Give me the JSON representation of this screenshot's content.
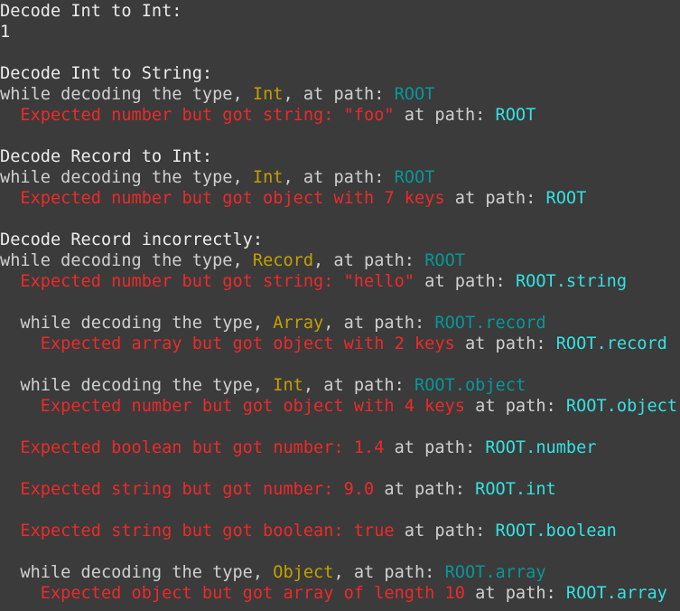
{
  "terminal": {
    "lines": [
      {
        "indent": 0,
        "segments": [
          {
            "c": "h",
            "t": "Decode Int to Int:"
          }
        ]
      },
      {
        "indent": 0,
        "segments": [
          {
            "c": "h",
            "t": "1"
          }
        ]
      },
      {
        "indent": 0,
        "segments": []
      },
      {
        "indent": 0,
        "segments": [
          {
            "c": "h",
            "t": "Decode Int to String:"
          }
        ]
      },
      {
        "indent": 0,
        "segments": [
          {
            "c": "w",
            "t": "while decoding the type, "
          },
          {
            "c": "y",
            "t": "Int"
          },
          {
            "c": "w",
            "t": ", at path: "
          },
          {
            "c": "dc",
            "t": "ROOT"
          }
        ]
      },
      {
        "indent": 2,
        "segments": [
          {
            "c": "r",
            "t": "Expected number but got string: \"foo\""
          },
          {
            "c": "w",
            "t": " at path: "
          },
          {
            "c": "bc",
            "t": "ROOT"
          }
        ]
      },
      {
        "indent": 0,
        "segments": []
      },
      {
        "indent": 0,
        "segments": [
          {
            "c": "h",
            "t": "Decode Record to Int:"
          }
        ]
      },
      {
        "indent": 0,
        "segments": [
          {
            "c": "w",
            "t": "while decoding the type, "
          },
          {
            "c": "y",
            "t": "Int"
          },
          {
            "c": "w",
            "t": ", at path: "
          },
          {
            "c": "dc",
            "t": "ROOT"
          }
        ]
      },
      {
        "indent": 2,
        "segments": [
          {
            "c": "r",
            "t": "Expected number but got object with 7 keys"
          },
          {
            "c": "w",
            "t": " at path: "
          },
          {
            "c": "bc",
            "t": "ROOT"
          }
        ]
      },
      {
        "indent": 0,
        "segments": []
      },
      {
        "indent": 0,
        "segments": [
          {
            "c": "h",
            "t": "Decode Record incorrectly:"
          }
        ]
      },
      {
        "indent": 0,
        "segments": [
          {
            "c": "w",
            "t": "while decoding the type, "
          },
          {
            "c": "y",
            "t": "Record"
          },
          {
            "c": "w",
            "t": ", at path: "
          },
          {
            "c": "dc",
            "t": "ROOT"
          }
        ]
      },
      {
        "indent": 2,
        "segments": [
          {
            "c": "r",
            "t": "Expected number but got string: \"hello\""
          },
          {
            "c": "w",
            "t": " at path: "
          },
          {
            "c": "bc",
            "t": "ROOT.string"
          }
        ]
      },
      {
        "indent": 0,
        "segments": []
      },
      {
        "indent": 2,
        "segments": [
          {
            "c": "w",
            "t": "while decoding the type, "
          },
          {
            "c": "y",
            "t": "Array"
          },
          {
            "c": "w",
            "t": ", at path: "
          },
          {
            "c": "dc",
            "t": "ROOT.record"
          }
        ]
      },
      {
        "indent": 4,
        "segments": [
          {
            "c": "r",
            "t": "Expected array but got object with 2 keys"
          },
          {
            "c": "w",
            "t": " at path: "
          },
          {
            "c": "bc",
            "t": "ROOT.record"
          }
        ]
      },
      {
        "indent": 0,
        "segments": []
      },
      {
        "indent": 2,
        "segments": [
          {
            "c": "w",
            "t": "while decoding the type, "
          },
          {
            "c": "y",
            "t": "Int"
          },
          {
            "c": "w",
            "t": ", at path: "
          },
          {
            "c": "dc",
            "t": "ROOT.object"
          }
        ]
      },
      {
        "indent": 4,
        "segments": [
          {
            "c": "r",
            "t": "Expected number but got object with 4 keys"
          },
          {
            "c": "w",
            "t": " at path: "
          },
          {
            "c": "bc",
            "t": "ROOT.object"
          }
        ]
      },
      {
        "indent": 0,
        "segments": []
      },
      {
        "indent": 2,
        "segments": [
          {
            "c": "r",
            "t": "Expected boolean but got number: 1.4"
          },
          {
            "c": "w",
            "t": " at path: "
          },
          {
            "c": "bc",
            "t": "ROOT.number"
          }
        ]
      },
      {
        "indent": 0,
        "segments": []
      },
      {
        "indent": 2,
        "segments": [
          {
            "c": "r",
            "t": "Expected string but got number: 9.0"
          },
          {
            "c": "w",
            "t": " at path: "
          },
          {
            "c": "bc",
            "t": "ROOT.int"
          }
        ]
      },
      {
        "indent": 0,
        "segments": []
      },
      {
        "indent": 2,
        "segments": [
          {
            "c": "r",
            "t": "Expected string but got boolean: true"
          },
          {
            "c": "w",
            "t": " at path: "
          },
          {
            "c": "bc",
            "t": "ROOT.boolean"
          }
        ]
      },
      {
        "indent": 0,
        "segments": []
      },
      {
        "indent": 2,
        "segments": [
          {
            "c": "w",
            "t": "while decoding the type, "
          },
          {
            "c": "y",
            "t": "Object"
          },
          {
            "c": "w",
            "t": ", at path: "
          },
          {
            "c": "dc",
            "t": "ROOT.array"
          }
        ]
      },
      {
        "indent": 4,
        "segments": [
          {
            "c": "r",
            "t": "Expected object but got array of length 10"
          },
          {
            "c": "w",
            "t": " at path: "
          },
          {
            "c": "bc",
            "t": "ROOT.array"
          }
        ]
      }
    ]
  },
  "colors": {
    "background": "#3b3b3b",
    "text": "#d0d0d0",
    "type_name": "#c4a000",
    "path_context": "#06989a",
    "error": "#ef2929",
    "path_error": "#34e2e2"
  }
}
